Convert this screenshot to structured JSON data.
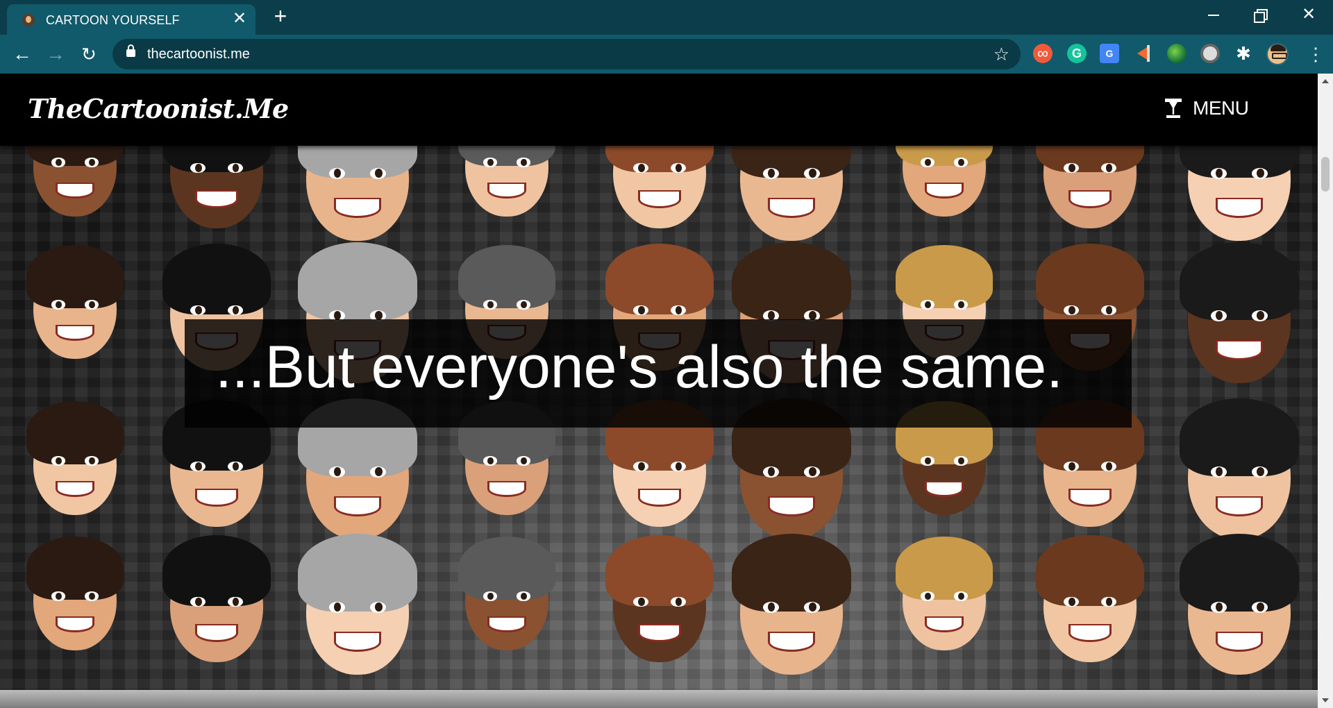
{
  "browser": {
    "tab_title": "CARTOON YOURSELF",
    "tab_close": "✕",
    "new_tab": "+",
    "url": "thecartoonist.me",
    "nav": {
      "back": "←",
      "forward": "→",
      "reload": "↻"
    },
    "star": "☆",
    "extensions": [
      {
        "name": "infinity-extension-icon",
        "glyph": "∞"
      },
      {
        "name": "grammarly-extension-icon",
        "glyph": "G"
      },
      {
        "name": "google-translate-extension-icon",
        "glyph": "G"
      },
      {
        "name": "flag-extension-icon",
        "glyph": ""
      },
      {
        "name": "globe-extension-icon",
        "glyph": ""
      },
      {
        "name": "circle-extension-icon",
        "glyph": ""
      },
      {
        "name": "puzzle-extensions-icon",
        "glyph": "✱"
      }
    ],
    "window": {
      "close": "✕"
    },
    "menu_dots": "⋮"
  },
  "site": {
    "logo": "TheCartoonist.Me",
    "menu_label": "MENU",
    "banner": "...But everyone's also the same."
  },
  "colors": {
    "chrome_dark": "#0b3d4b",
    "chrome_tab": "#105a6c",
    "site_header": "#000000"
  }
}
